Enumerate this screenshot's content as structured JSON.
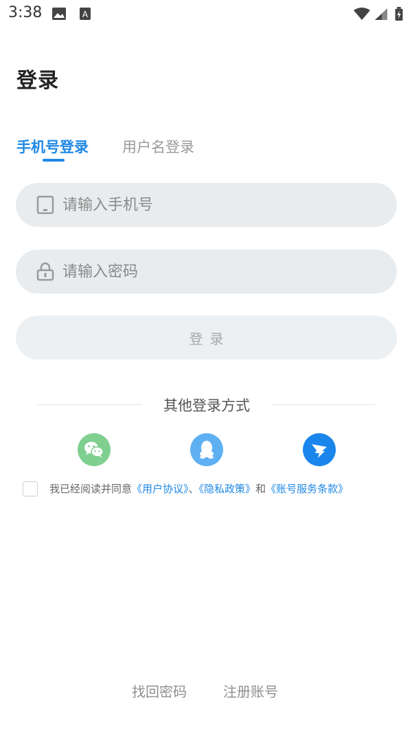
{
  "status_bar": {
    "time": "3:38",
    "icons": [
      "gallery-icon",
      "font-app-icon",
      "wifi-icon",
      "cell-signal-icon",
      "battery-charging-icon"
    ]
  },
  "title": "登录",
  "tabs": [
    {
      "label": "手机号登录",
      "active": true
    },
    {
      "label": "用户名登录",
      "active": false
    }
  ],
  "phone_input": {
    "placeholder": "请输入手机号",
    "value": "",
    "icon": "phone-icon"
  },
  "password_input": {
    "placeholder": "请输入密码",
    "value": "",
    "icon": "lock-icon"
  },
  "login_button": {
    "label": "登录"
  },
  "other_login": {
    "label": "其他登录方式",
    "methods": [
      {
        "name": "wechat",
        "icon": "wechat-icon",
        "color": "#7fcf8f"
      },
      {
        "name": "qq",
        "icon": "qq-icon",
        "color": "#5fb0f2"
      },
      {
        "name": "dingtalk",
        "icon": "dingtalk-icon",
        "color": "#1a86ec"
      }
    ]
  },
  "agreement": {
    "checked": false,
    "prefix": "我已经阅读并同意",
    "user_agreement": "《用户协议》",
    "separator": "、",
    "privacy_policy": "《隐私政策》",
    "conjunction": "和",
    "account_terms": "《账号服务条款》"
  },
  "footer": {
    "forgot_password": "找回密码",
    "register": "注册账号"
  },
  "colors": {
    "accent": "#1e88e5",
    "input_bg": "#e9ecef",
    "button_bg": "#edf0f2"
  }
}
